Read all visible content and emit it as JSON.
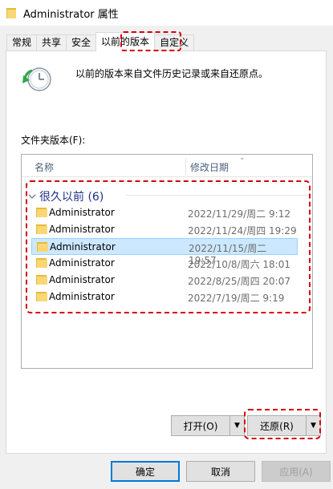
{
  "window": {
    "title": "Administrator 属性"
  },
  "tabs": [
    {
      "label": "常规"
    },
    {
      "label": "共享"
    },
    {
      "label": "安全"
    },
    {
      "label": "以前的版本",
      "active": true
    },
    {
      "label": "自定义"
    }
  ],
  "panel": {
    "description": "以前的版本来自文件历史记录或来自还原点。",
    "folder_versions_label": "文件夹版本(F):",
    "columns": {
      "name": "名称",
      "date": "修改日期"
    },
    "group": {
      "label": "很久以前 (6)"
    },
    "rows": [
      {
        "name": "Administrator",
        "date": "2022/11/29/周二 9:12"
      },
      {
        "name": "Administrator",
        "date": "2022/11/24/周四 19:29"
      },
      {
        "name": "Administrator",
        "date": "2022/11/15/周二 19:57",
        "selected": true
      },
      {
        "name": "Administrator",
        "date": "2022/10/8/周六 18:01"
      },
      {
        "name": "Administrator",
        "date": "2022/8/25/周四 20:07"
      },
      {
        "name": "Administrator",
        "date": "2022/7/19/周二 9:19"
      }
    ],
    "open_button": "打开(O)",
    "restore_button": "还原(R)"
  },
  "footer": {
    "ok": "确定",
    "cancel": "取消",
    "apply": "应用(A)"
  },
  "colors": {
    "highlight": "#d6000f",
    "selected_row": "#cce8ff",
    "group_text": "#1e3287",
    "folder": "#f8d775"
  }
}
